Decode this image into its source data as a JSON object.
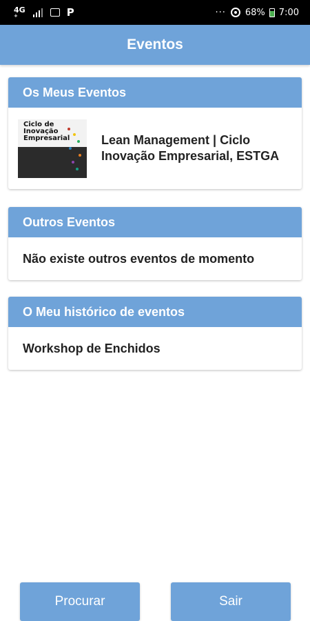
{
  "status_bar": {
    "network": "4G",
    "network_sub": "+",
    "battery": "68%",
    "time": "7:00",
    "more": "···",
    "parking": "P"
  },
  "app_bar": {
    "title": "Eventos"
  },
  "my_events": {
    "header": "Os Meus Eventos",
    "items": [
      {
        "title": "Lean Management | Ciclo Inovação Empresarial, ESTGA",
        "thumbnail_text": "Ciclo de Inovação Empresarial"
      }
    ]
  },
  "other_events": {
    "header": "Outros Eventos",
    "empty_message": "Não existe outros eventos de momento"
  },
  "history": {
    "header": "O Meu histórico de eventos",
    "items": [
      {
        "title": "Workshop de Enchidos"
      }
    ]
  },
  "buttons": {
    "search": "Procurar",
    "exit": "Sair"
  },
  "colors": {
    "primary": "#6fa3d9",
    "status_bar": "#000000",
    "background": "#ffffff"
  }
}
